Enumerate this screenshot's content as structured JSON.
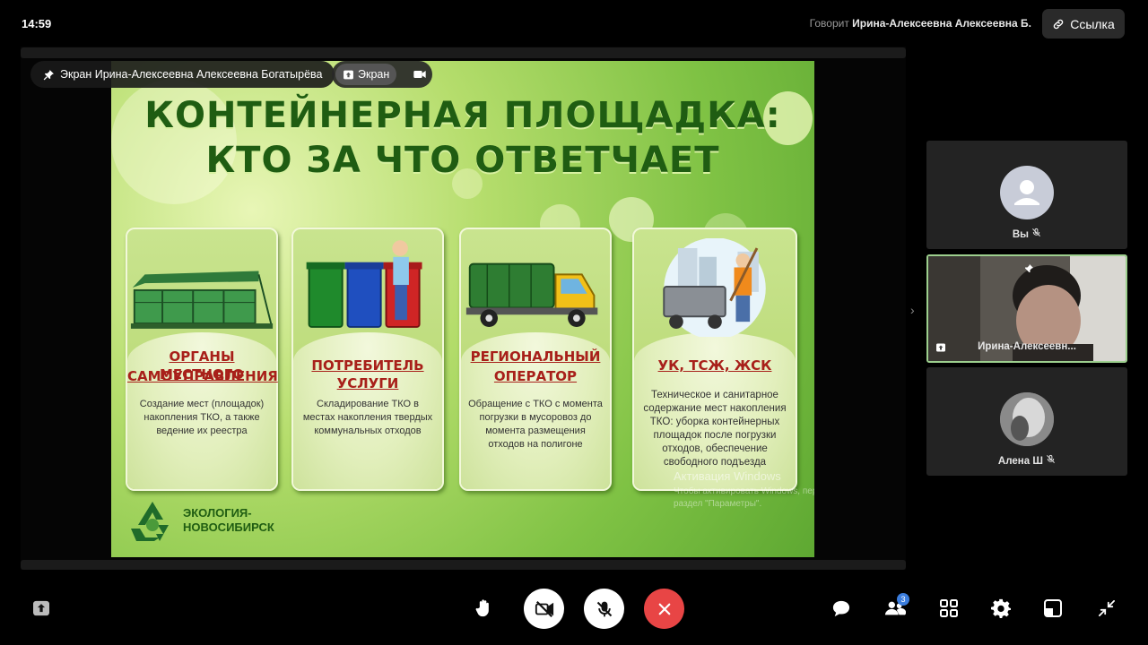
{
  "topbar": {
    "time": "14:59",
    "speaker_prefix": "Говорит",
    "speaker_name": "Ирина-Алексеевна Алексеевна Б.",
    "link_label": "Ссылка"
  },
  "stage": {
    "pin_label": "Экран Ирина-Алексеевна Алексеевна Богатырёва",
    "screen_label": "Экран"
  },
  "slide": {
    "title_line1": "КОНТЕЙНЕРНАЯ ПЛОЩАДКА:",
    "title_line2": "КТО ЗА ЧТО ОТВЕТЧАЕТ",
    "cards": [
      {
        "head_line1": "ОРГАНЫ МЕСТНОГО",
        "head_line2": "САМОУПРАВЛЕНИЯ",
        "desc": "Создание мест (площадок) накопления ТКО, а также ведение их реестра"
      },
      {
        "head_line1": "ПОТРЕБИТЕЛЬ УСЛУГИ",
        "head_line2": "",
        "desc": "Складирование ТКО в местах накопления твердых коммунальных отходов"
      },
      {
        "head_line1": "РЕГИОНАЛЬНЫЙ",
        "head_line2": "ОПЕРАТОР",
        "desc": "Обращение с ТКО с момента погрузки в мусоровоз до момента размещения отходов на полигоне"
      },
      {
        "head_line1": "УК, ТСЖ, ЖСК",
        "head_line2": "",
        "desc": "Техническое и санитарное содержание мест накопления ТКО: уборка контейнерных площадок после погрузки отходов, обеспечение свободного подъезда"
      }
    ],
    "brand_line1": "ЭКОЛОГИЯ-",
    "brand_line2": "НОВОСИБИРСК",
    "watermark_title": "Активация Windows",
    "watermark_sub": "Чтобы активировать Windows, перейдите в раздел \"Параметры\"."
  },
  "participants": [
    {
      "name": "Вы"
    },
    {
      "name": "Ирина-Алексеевн..."
    },
    {
      "name": "Алена Ш"
    }
  ],
  "controls": {
    "participants_count": "3"
  },
  "colors": {
    "end_call": "#e84545",
    "accent_blue": "#3b7ddd",
    "title_green": "#1f5d12",
    "card_head_red": "#a8201a"
  }
}
